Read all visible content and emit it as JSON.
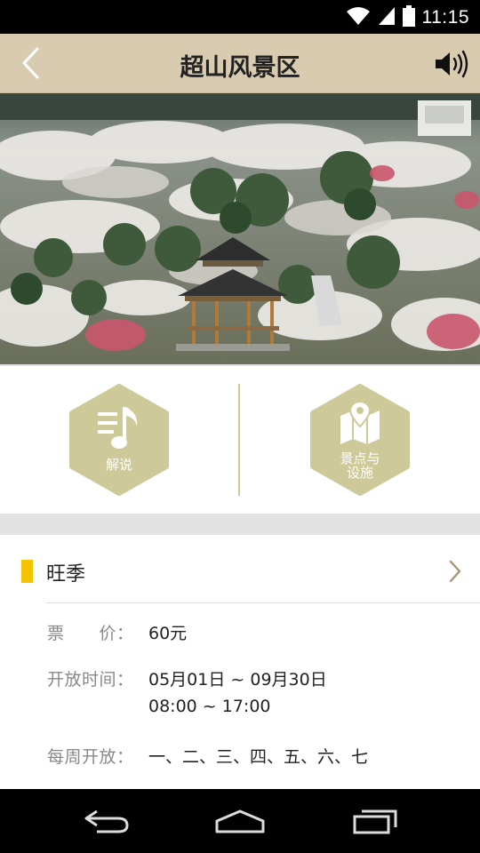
{
  "status": {
    "time": "11:15"
  },
  "header": {
    "title": "超山风景区"
  },
  "actions": [
    {
      "label": "解说"
    },
    {
      "label_line1": "景点与",
      "label_line2": "设施"
    }
  ],
  "info": {
    "section_title": "旺季",
    "rows": [
      {
        "label": "票　　价：",
        "value": "60元"
      },
      {
        "label": "开放时间：",
        "value": "05月01日 ~ 09月30日",
        "value2": "08:00 ~ 17:00"
      },
      {
        "label": "每周开放：",
        "value": "一、二、三、四、五、六、七"
      }
    ]
  },
  "colors": {
    "title_bar": "#d8cbb0",
    "hex_fill": "#cdc999",
    "season_marker": "#f5c400"
  }
}
